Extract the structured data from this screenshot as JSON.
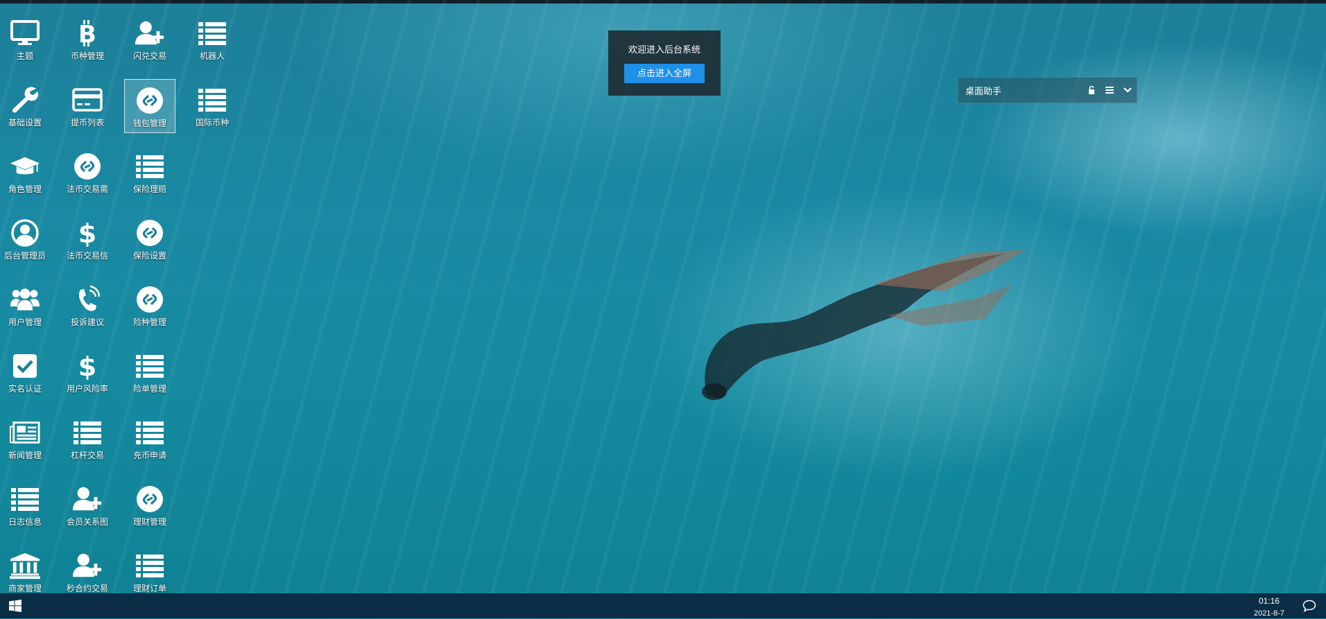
{
  "desktop": {
    "icons": [
      {
        "label": "主题",
        "icon": "monitor-icon"
      },
      {
        "label": "币种管理",
        "icon": "bitcoin-icon"
      },
      {
        "label": "闪兑交易",
        "icon": "user-plus-icon"
      },
      {
        "label": "机器人",
        "icon": "list-icon"
      },
      {
        "label": "基础设置",
        "icon": "wrench-icon"
      },
      {
        "label": "提币列表",
        "icon": "credit-card-icon"
      },
      {
        "label": "钱包管理",
        "icon": "link-circle-icon",
        "selected": true
      },
      {
        "label": "国际币种",
        "icon": "list-icon"
      },
      {
        "label": "角色管理",
        "icon": "graduation-cap-icon"
      },
      {
        "label": "法币交易需",
        "icon": "link-circle-icon"
      },
      {
        "label": "保险理赔",
        "icon": "list-icon"
      },
      {
        "label": "后台管理员",
        "icon": "user-circle-icon"
      },
      {
        "label": "法币交易信",
        "icon": "dollar-icon"
      },
      {
        "label": "保险设置",
        "icon": "link-circle-icon"
      },
      {
        "label": "用户管理",
        "icon": "users-icon"
      },
      {
        "label": "投诉建议",
        "icon": "phone-icon"
      },
      {
        "label": "险种管理",
        "icon": "link-circle-icon"
      },
      {
        "label": "实名认证",
        "icon": "check-square-icon"
      },
      {
        "label": "用户风险率",
        "icon": "dollar-icon"
      },
      {
        "label": "险单管理",
        "icon": "list-icon"
      },
      {
        "label": "新闻管理",
        "icon": "newspaper-icon"
      },
      {
        "label": "杠杆交易",
        "icon": "list-icon"
      },
      {
        "label": "充币申请",
        "icon": "list-icon"
      },
      {
        "label": "日志信息",
        "icon": "list-icon"
      },
      {
        "label": "会员关系图",
        "icon": "user-plus-icon"
      },
      {
        "label": "理财管理",
        "icon": "link-circle-icon"
      },
      {
        "label": "商家管理",
        "icon": "bank-icon"
      },
      {
        "label": "秒合约交易",
        "icon": "user-plus-icon"
      },
      {
        "label": "理财订单",
        "icon": "list-icon"
      }
    ]
  },
  "welcome": {
    "message": "欢迎进入后台系统",
    "button": "点击进入全屏"
  },
  "assistant": {
    "title": "桌面助手",
    "icons": [
      "lock-icon",
      "menu-icon",
      "chevron-down-icon"
    ]
  },
  "taskbar": {
    "start_icon": "windows-icon",
    "time": "01:16",
    "date": "2021-8-7",
    "notify_icon": "chat-icon"
  },
  "colors": {
    "taskbar": "#0b2d46",
    "button": "#1e90e8",
    "panel": "#1e282d"
  }
}
